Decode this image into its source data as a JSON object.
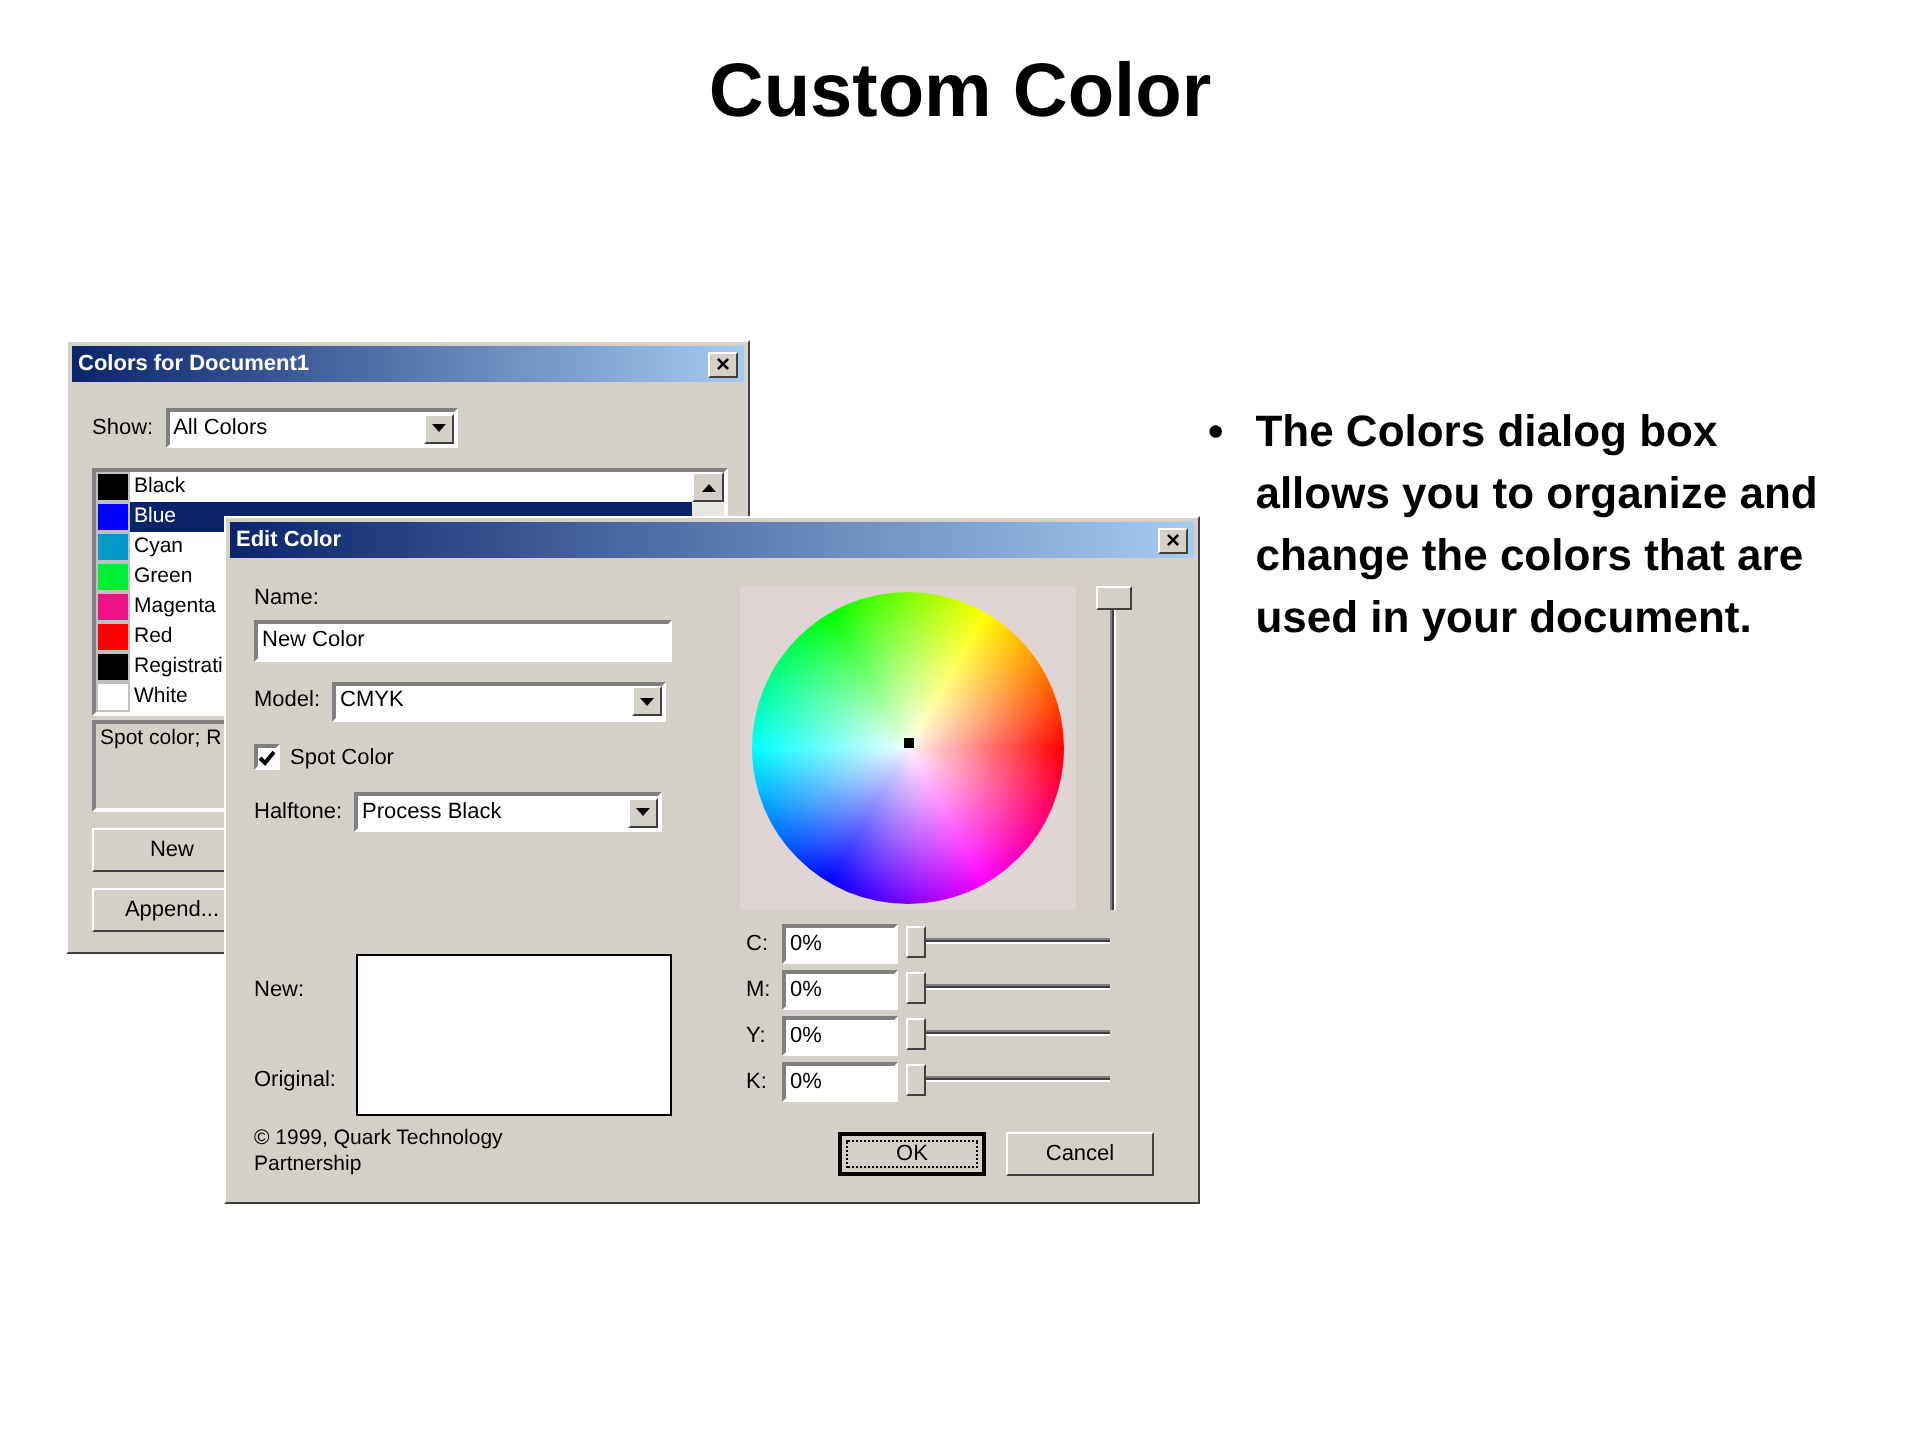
{
  "slide": {
    "title": "Custom Color",
    "bullets": [
      {
        "marker": "•",
        "text": "The Colors dialog box allows you to organize and change the colors that are used in your document."
      }
    ]
  },
  "colors_dialog": {
    "title": "Colors for Document1",
    "close": "×",
    "show_label": "Show:",
    "show_value": "All Colors",
    "colors": [
      {
        "name": "Black",
        "color": "#000000",
        "selected": false
      },
      {
        "name": "Blue",
        "color": "#0000ff",
        "selected": true
      },
      {
        "name": "Cyan",
        "color": "#0099c8",
        "selected": false
      },
      {
        "name": "Green",
        "color": "#00ee33",
        "selected": false
      },
      {
        "name": "Magenta",
        "color": "#ee1188",
        "selected": false
      },
      {
        "name": "Red",
        "color": "#ff0000",
        "selected": false
      },
      {
        "name": "Registrati",
        "color": "#000000",
        "selected": false
      },
      {
        "name": "White",
        "color": "#ffffff",
        "selected": false
      }
    ],
    "info": "Spot color; R",
    "buttons": [
      "New",
      "Append..."
    ]
  },
  "edit_dialog": {
    "title": "Edit Color",
    "close": "×",
    "name_label": "Name:",
    "name_value": "New Color",
    "model_label": "Model:",
    "model_value": "CMYK",
    "spot_label": "Spot Color",
    "spot_checked": true,
    "halftone_label": "Halftone:",
    "halftone_value": "Process Black",
    "new_label": "New:",
    "original_label": "Original:",
    "copyright": "© 1999, Quark Technology Partnership",
    "brightness": {
      "level": 1
    },
    "channels": [
      {
        "label": "C:",
        "value": "0%",
        "level": 0
      },
      {
        "label": "M:",
        "value": "0%",
        "level": 0
      },
      {
        "label": "Y:",
        "value": "0%",
        "level": 0
      },
      {
        "label": "K:",
        "value": "0%",
        "level": 0
      }
    ],
    "buttons": [
      {
        "label": "OK",
        "default": true
      },
      {
        "label": "Cancel",
        "default": false
      }
    ]
  }
}
